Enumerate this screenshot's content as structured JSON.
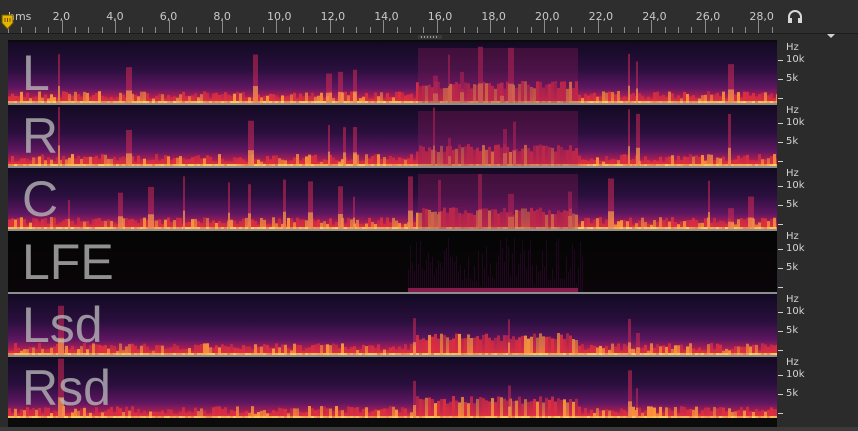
{
  "ruler": {
    "unit_label": "hms",
    "tick_labels": [
      "2,0",
      "4,0",
      "6,0",
      "8,0",
      "10,0",
      "12,0",
      "14,0",
      "16,0",
      "18,0",
      "20,0",
      "22,0",
      "24,0",
      "26,0",
      "28,0"
    ]
  },
  "channels": [
    {
      "label": "L"
    },
    {
      "label": "R"
    },
    {
      "label": "C"
    },
    {
      "label": "LFE"
    },
    {
      "label": "Lsd"
    },
    {
      "label": "Rsd"
    }
  ],
  "freq_axis": {
    "unit": "Hz",
    "label_10k": "10k",
    "label_5k": "5k"
  },
  "icons": {
    "headphones": "headphones-icon",
    "playhead": "playhead-marker-icon",
    "menu": "chevron-down-icon"
  },
  "colors": {
    "background": "#2b2b2b",
    "spectral_low": "#1a0a2a",
    "spectral_mid": "#7a1e7a",
    "spectral_high": "#e0303a",
    "spectral_peak": "#ffd060",
    "playhead": "#e8b400"
  }
}
